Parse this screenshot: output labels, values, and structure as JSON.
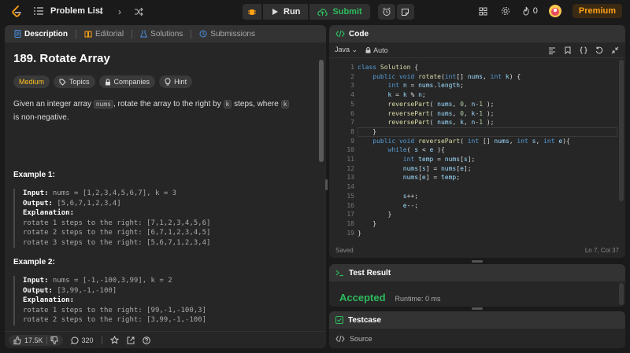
{
  "nav": {
    "problem_list": "Problem List",
    "run": "Run",
    "submit": "Submit",
    "streak": "0",
    "premium": "Premium"
  },
  "tabs": [
    "Description",
    "Editorial",
    "Solutions",
    "Submissions"
  ],
  "problem": {
    "title": "189. Rotate Array",
    "difficulty": "Medium",
    "tags": [
      "Topics",
      "Companies",
      "Hint"
    ],
    "desc_1": "Given an integer array ",
    "desc_code_nums": "nums",
    "desc_2": ", rotate the array to the right by ",
    "desc_code_k": "k",
    "desc_3": " steps, where ",
    "desc_4": " is non-negative."
  },
  "examples": [
    {
      "title": "Example 1:",
      "input_label": "Input:",
      "input": " nums = [1,2,3,4,5,6,7], k = 3",
      "output_label": "Output:",
      "output": " [5,6,7,1,2,3,4]",
      "explanation_label": "Explanation:",
      "explanation": [
        "rotate 1 steps to the right: [7,1,2,3,4,5,6]",
        "rotate 2 steps to the right: [6,7,1,2,3,4,5]",
        "rotate 3 steps to the right: [5,6,7,1,2,3,4]"
      ]
    },
    {
      "title": "Example 2:",
      "input_label": "Input:",
      "input": " nums = [-1,-100,3,99], k = 2",
      "output_label": "Output:",
      "output": " [3,99,-1,-100]",
      "explanation_label": "Explanation:",
      "explanation": [
        "rotate 1 steps to the right: [99,-1,-100,3]",
        "rotate 2 steps to the right: [3,99,-1,-100]"
      ]
    }
  ],
  "footer": {
    "likes": "17.5K",
    "comments": "320"
  },
  "editor": {
    "title": "Code",
    "language": "Java",
    "mode": "Auto",
    "saved": "Saved",
    "cursor": "Ln 7, Col 37",
    "line_numbers": [
      "1",
      "2",
      "3",
      "4",
      "5",
      "6",
      "7",
      "8",
      "9",
      "10",
      "11",
      "12",
      "13",
      "14",
      "15",
      "16",
      "17",
      "18",
      "19"
    ]
  },
  "result": {
    "title": "Test Result",
    "status": "Accepted",
    "runtime": "Runtime: 0 ms"
  },
  "testcase": {
    "title": "Testcase",
    "source": "Source"
  },
  "colors": {
    "accent": "#ffa116",
    "green": "#2cbb5d",
    "medium": "#ffc01e",
    "bg": "#1a1a1a",
    "panel": "#262626"
  }
}
